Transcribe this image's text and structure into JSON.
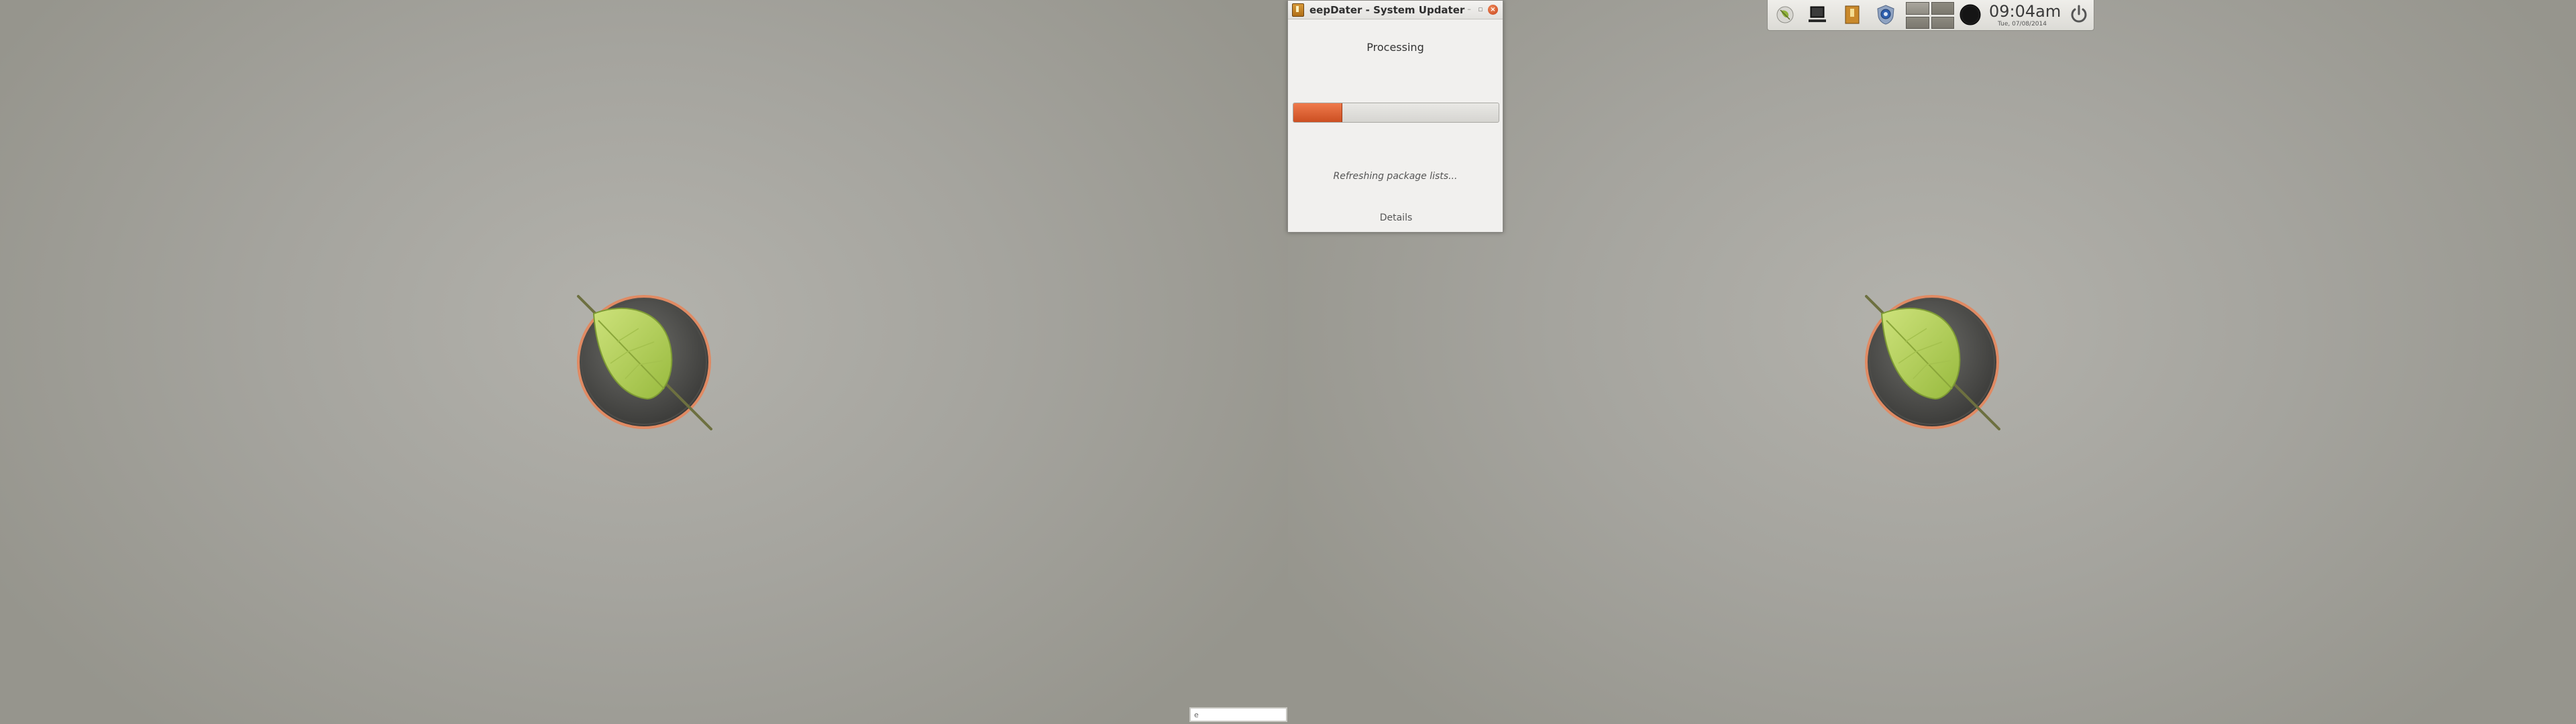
{
  "updater": {
    "title": "eepDater - System Updater",
    "heading": "Processing",
    "progress_fraction": 0.24,
    "status": "Refreshing package lists...",
    "details_label": "Details",
    "close_symbol": "×",
    "min_symbol": "–",
    "max_symbol": "▫"
  },
  "panel": {
    "icons": [
      "leaf-menu-icon",
      "monitor-icon",
      "package-icon",
      "shield-icon"
    ],
    "time": "09:04am",
    "date": "Tue, 07/08/2014",
    "workspaces": 4,
    "active_workspace": 0
  },
  "colors": {
    "accent": "#d9592b",
    "leaf": "#b5d460",
    "ring": "#e08a63"
  },
  "search": {
    "value": "e"
  }
}
